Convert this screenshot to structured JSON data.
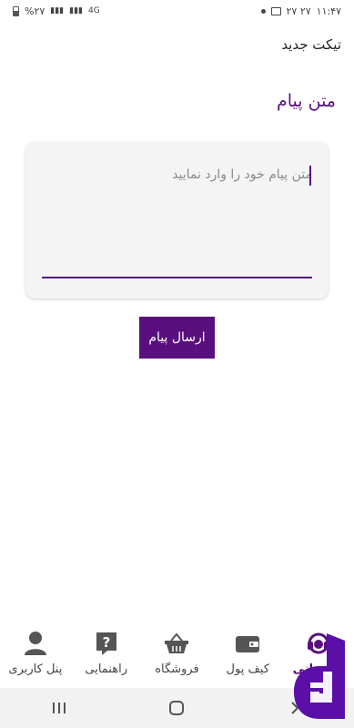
{
  "status_bar": {
    "left_text": "%۲۷",
    "network": "4G",
    "right_time": "۱۱:۴۷",
    "right_text": "۲۷  ۲۷"
  },
  "header": {
    "title": "تیکت جدید"
  },
  "form": {
    "heading": "متن پیام",
    "message_placeholder": "متن پیام خود را وارد نمایید",
    "message_value": "",
    "send_label": "ارسال پیام"
  },
  "bottom_nav": {
    "items": [
      {
        "label": "پشتیبانی",
        "icon": "support-headset-icon",
        "active": true
      },
      {
        "label": "کیف پول",
        "icon": "wallet-icon",
        "active": false
      },
      {
        "label": "فروشگاه",
        "icon": "basket-icon",
        "active": false
      },
      {
        "label": "راهنمایی",
        "icon": "help-icon",
        "active": false
      },
      {
        "label": "پنل کاربری",
        "icon": "user-icon",
        "active": false
      }
    ]
  },
  "system_nav": {
    "buttons": [
      "recents-icon",
      "home-icon",
      "back-icon"
    ]
  },
  "colors": {
    "accent": "#5a0f7e",
    "card_bg": "#f4f4f4",
    "watermark": "#5b0fa8"
  }
}
